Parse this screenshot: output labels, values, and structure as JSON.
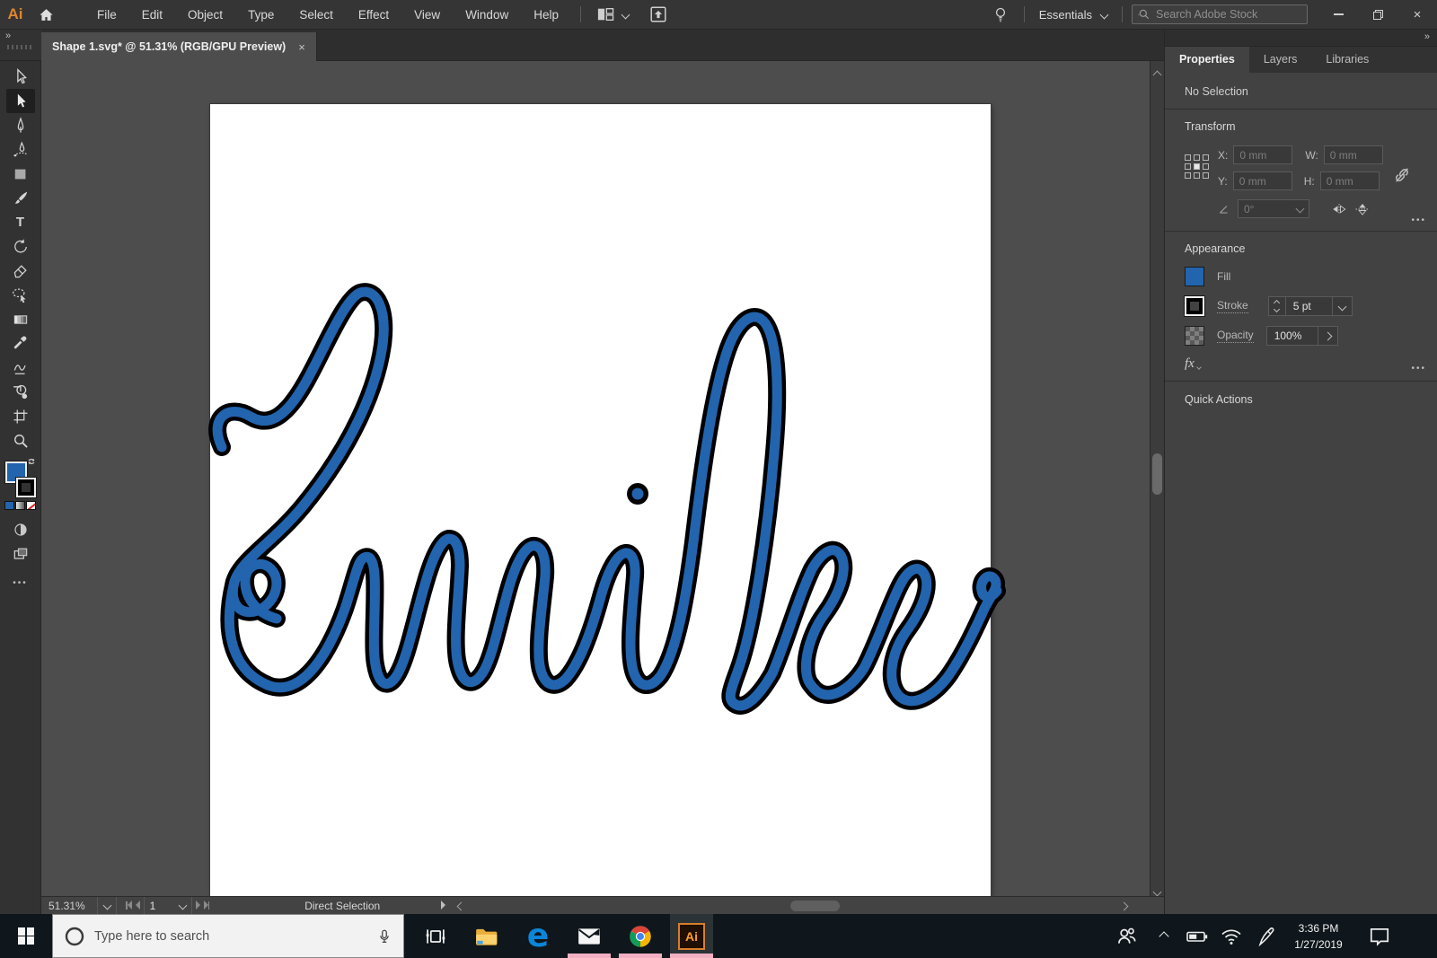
{
  "titlebar": {
    "app": "Ai",
    "menus": [
      "File",
      "Edit",
      "Object",
      "Type",
      "Select",
      "Effect",
      "View",
      "Window",
      "Help"
    ],
    "workspace": "Essentials",
    "search_placeholder": "Search Adobe Stock"
  },
  "tab": {
    "title": "Shape 1.svg* @ 51.31% (RGB/GPU Preview)"
  },
  "panel": {
    "tabs": {
      "properties": "Properties",
      "layers": "Layers",
      "libraries": "Libraries"
    },
    "no_selection": "No Selection",
    "transform": {
      "title": "Transform",
      "x": "X:",
      "x_value": "0 mm",
      "y": "Y:",
      "y_value": "0 mm",
      "w": "W:",
      "w_value": "0 mm",
      "h": "H:",
      "h_value": "0 mm",
      "angle_value": "0°"
    },
    "appearance": {
      "title": "Appearance",
      "fill": "Fill",
      "stroke": "Stroke",
      "stroke_weight": "5 pt",
      "opacity": "Opacity",
      "opacity_value": "100%"
    },
    "quick_actions": "Quick Actions"
  },
  "statusbar": {
    "zoom": "51.31%",
    "artboard": "1",
    "tool": "Direct Selection"
  },
  "canvas": {
    "word": "Emilee",
    "fill_color": "#2264ae",
    "outline_color": "#000000"
  },
  "taskbar": {
    "search_placeholder": "Type here to search",
    "time": "3:36 PM",
    "date": "1/27/2019"
  },
  "glyphs": {
    "collapse": "»",
    "close": "×",
    "type_tool": "T",
    "fx": "fx",
    "ellipsis": "•••",
    "minimize": "–",
    "edge": "e"
  },
  "colors": {
    "accent_blue": "#2264ae",
    "ai_orange": "#e0862f",
    "chrome_ui": "#323232",
    "pasteboard": "#4d4d4d",
    "taskbar_bg": "#0f171c",
    "running_indicator": "#f2afc1",
    "edge_blue": "#0c86d8",
    "folder_yellow": "#f6c64b",
    "chrome_red": "#db4437",
    "chrome_yellow": "#f4b400",
    "chrome_green": "#0f9d58",
    "chrome_blue": "#4285f4"
  }
}
